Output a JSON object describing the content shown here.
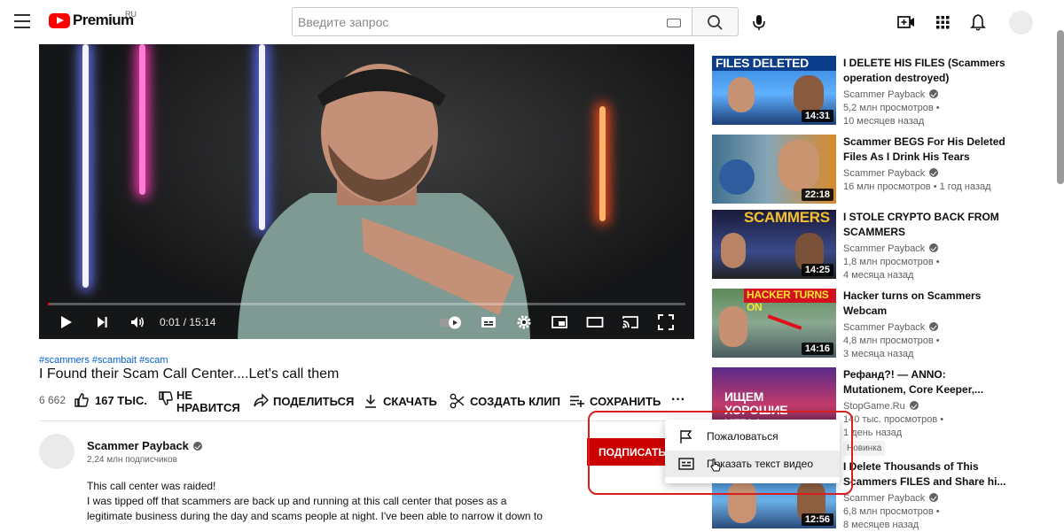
{
  "header": {
    "logo_text": "Premium",
    "logo_region": "RU",
    "search_placeholder": "Введите запрос"
  },
  "player": {
    "timecode": "0:01 / 15:14",
    "progress": 0.001
  },
  "video": {
    "tags": "#scammers #scambait #scam",
    "title": "I Found their Scam Call Center....Let's call them",
    "views": "6 662",
    "likes": "167 ТЫС.",
    "dislike_line1": "НЕ",
    "dislike_line2": "НРАВИТСЯ",
    "share": "ПОДЕЛИТЬСЯ",
    "download": "СКАЧАТЬ",
    "clip": "СОЗДАТЬ КЛИП",
    "save": "СОХРАНИТЬ",
    "more": "···"
  },
  "channel": {
    "name": "Scammer Payback",
    "subscribers": "2,24 млн подписчиков",
    "subscribe_label": "ПОДПИСАТЬ",
    "description_lines": [
      "This call center was raided!",
      "I was tipped off that scammers are back up and running at this call center that poses as a",
      "legitimate business during the day and scams people at night. I've been able to narrow it down to"
    ]
  },
  "menu": {
    "report": "Пожаловаться",
    "transcript": "Показать текст видео"
  },
  "sidebar": [
    {
      "thumb_caption": "FILES DELETED",
      "duration": "14:31",
      "title": "I DELETE HIS FILES (Scammers operation destroyed)",
      "channel": "Scammer Payback",
      "views": "5,2 млн просмотров",
      "age": "10 месяцев назад"
    },
    {
      "thumb_caption": "",
      "duration": "22:18",
      "title": "Scammer BEGS For His Deleted Files As I Drink His Tears",
      "channel": "Scammer Payback",
      "views": "16 млн просмотров",
      "age": "1 год назад"
    },
    {
      "thumb_caption": "SCAMMERS",
      "duration": "14:25",
      "title": "I STOLE CRYPTO BACK FROM SCAMMERS",
      "channel": "Scammer Payback",
      "views": "1,8 млн просмотров",
      "age": "4 месяца назад"
    },
    {
      "thumb_caption": "HACKER TURNS ON",
      "duration": "14:16",
      "title": "Hacker turns on Scammers Webcam",
      "channel": "Scammer Payback",
      "views": "4,8 млн просмотров",
      "age": "3 месяца назад"
    },
    {
      "thumb_caption": "ИЩЕМ ХОРОШИЕ ИГРЫ",
      "duration": "",
      "title": "Рефанд?! — ANNO: Mutationem, Core Keeper,...",
      "channel": "StopGame.Ru",
      "views": "140 тыс. просмотров",
      "age": "1 день назад",
      "badge": "Новинка"
    },
    {
      "thumb_caption": "",
      "duration": "12:56",
      "title": "I Delete Thousands of This Scammers FILES and Share hi...",
      "channel": "Scammer Payback",
      "views": "6,8 млн просмотров",
      "age": "8 месяцев назад"
    }
  ],
  "colors": {
    "accent_red": "#ff0000",
    "subscribe_red": "#cc0000",
    "link_blue": "#065fd4",
    "highlight_red": "#d81f1f"
  }
}
